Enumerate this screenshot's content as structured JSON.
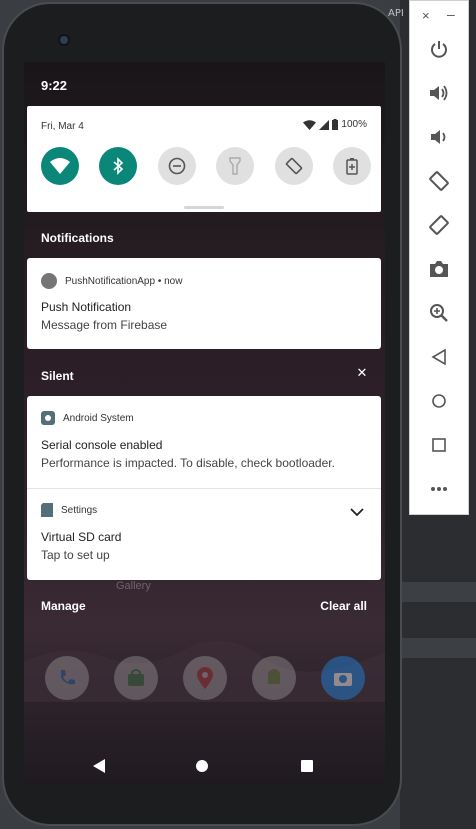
{
  "ide": {
    "api_fragment": "API"
  },
  "status_bar": {
    "time": "9:22"
  },
  "quick_settings": {
    "date": "Fri, Mar 4",
    "battery": "100%",
    "tiles": [
      {
        "name": "wifi-tile",
        "icon": "wifi-icon",
        "state": "on"
      },
      {
        "name": "bluetooth-tile",
        "icon": "bluetooth-icon",
        "state": "on"
      },
      {
        "name": "do-not-disturb-tile",
        "icon": "do-not-disturb-icon",
        "state": "off"
      },
      {
        "name": "flashlight-tile",
        "icon": "flashlight-icon",
        "state": "off"
      },
      {
        "name": "auto-rotate-tile",
        "icon": "auto-rotate-icon",
        "state": "off"
      },
      {
        "name": "battery-saver-tile",
        "icon": "battery-saver-icon",
        "state": "off"
      }
    ],
    "accent_color": "#0b877a"
  },
  "notifications": {
    "header": "Notifications",
    "push": {
      "app_meta": "PushNotificationApp • now",
      "title": "Push Notification",
      "text": "Message from Firebase"
    }
  },
  "silent": {
    "header": "Silent",
    "android_system": {
      "app": "Android System",
      "title": "Serial console enabled",
      "text": "Performance is impacted. To disable, check bootloader."
    },
    "settings": {
      "app": "Settings",
      "title": "Virtual SD card",
      "text": "Tap to set up"
    }
  },
  "home": {
    "gallery_label": "Gallery"
  },
  "footer": {
    "manage": "Manage",
    "clear_all": "Clear all"
  },
  "dock": [
    "phone-icon",
    "store-icon",
    "maps-icon",
    "android-icon",
    "camera-icon"
  ],
  "emulator_toolbar": {
    "close": "×",
    "minimize": "–",
    "tools": [
      "power-icon",
      "volume-up-icon",
      "volume-down-icon",
      "rotate-left-icon",
      "rotate-right-icon",
      "screenshot-icon",
      "zoom-icon",
      "back-icon",
      "home-icon",
      "overview-icon",
      "more-icon"
    ]
  }
}
